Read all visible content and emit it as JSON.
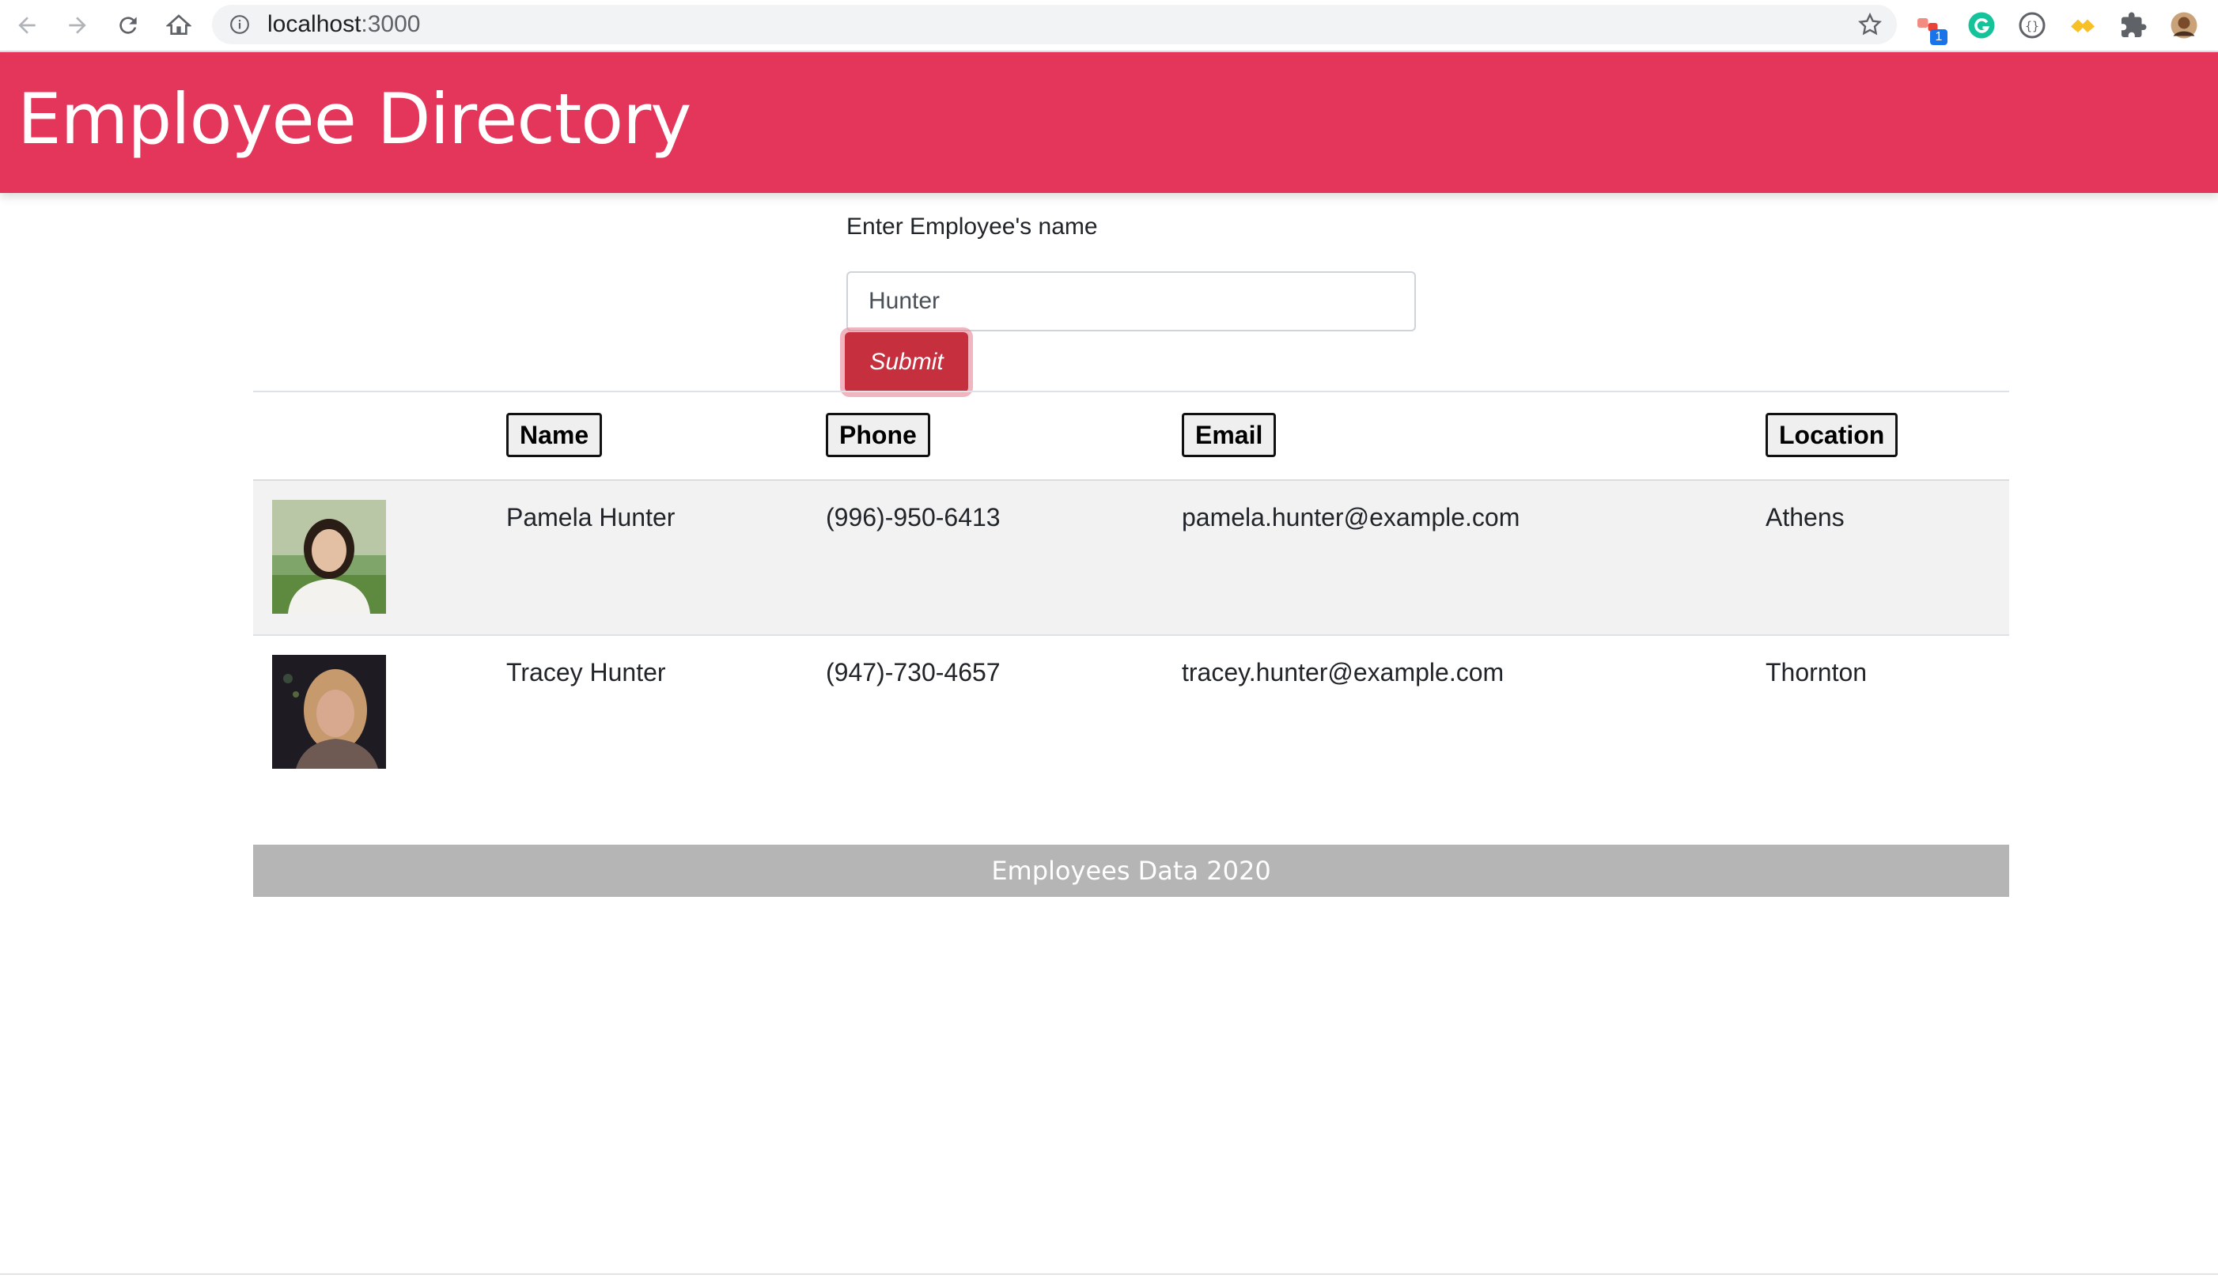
{
  "browser": {
    "url_host": "localhost",
    "url_port": ":3000",
    "extension_badge": "1"
  },
  "header": {
    "title": "Employee Directory",
    "background": "#e3365a"
  },
  "search": {
    "label": "Enter Employee's name",
    "value": "Hunter",
    "submit_label": "Submit"
  },
  "table": {
    "columns": {
      "name": "Name",
      "phone": "Phone",
      "email": "Email",
      "location": "Location"
    },
    "rows": [
      {
        "name": "Pamela Hunter",
        "phone": "(996)-950-6413",
        "email": "pamela.hunter@example.com",
        "location": "Athens"
      },
      {
        "name": "Tracey Hunter",
        "phone": "(947)-730-4657",
        "email": "tracey.hunter@example.com",
        "location": "Thornton"
      }
    ]
  },
  "footer": {
    "text": "Employees Data 2020"
  }
}
